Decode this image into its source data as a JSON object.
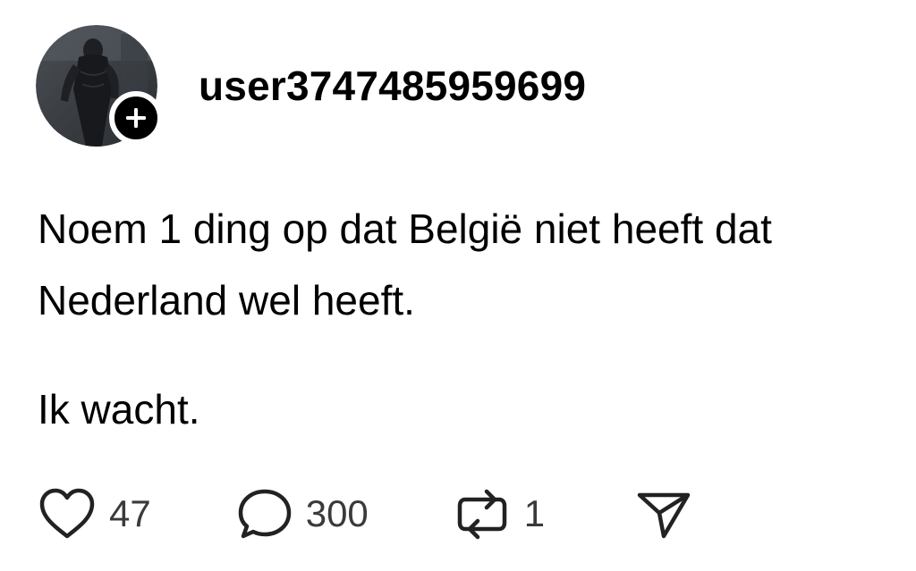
{
  "post": {
    "username": "user3747485959699",
    "text_lines": [
      "Noem 1 ding op dat België niet heeft dat",
      "Nederland wel heeft."
    ],
    "second_paragraph": "Ik wacht."
  },
  "actions": {
    "likes": "47",
    "comments": "300",
    "reposts": "1"
  },
  "icons": {
    "like": "heart-icon",
    "comment": "speech-bubble-icon",
    "repost": "repost-arrows-icon",
    "share": "paper-plane-icon",
    "follow": "plus-icon"
  },
  "colors": {
    "text": "#000000",
    "count_text": "#3a3a3a",
    "badge": "#000000"
  }
}
